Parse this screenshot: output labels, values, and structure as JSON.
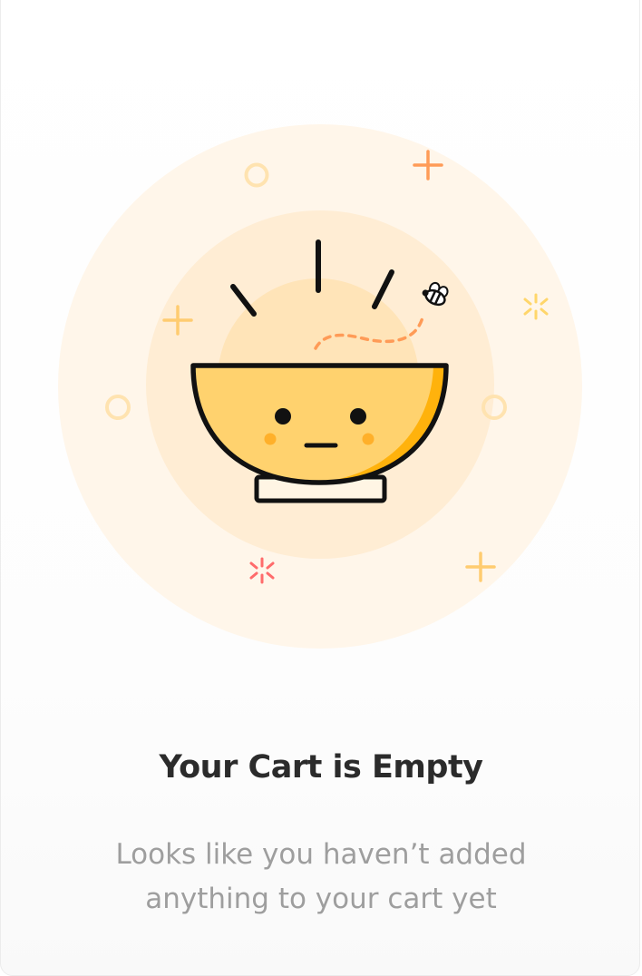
{
  "empty_state": {
    "title": "Your Cart is Empty",
    "message_line1": "Looks like you haven’t added",
    "message_line2": "anything to your cart yet"
  },
  "illustration": {
    "subject": "smiling-bowl",
    "decorations": [
      "plus-sign",
      "ring",
      "sparkle",
      "bee"
    ]
  },
  "colors": {
    "outer_glow": "#fff6ea",
    "middle_glow": "#ffedd4",
    "inner_glow": "#ffe4b8",
    "bowl_fill": "#ffd26e",
    "bowl_shadow": "#ffb20c",
    "outline": "#111111",
    "cheek": "#ffb02a",
    "title": "#2b2b2b",
    "message": "#9e9e9e",
    "accent_orange": "#ff9b57",
    "accent_yellow": "#ffd66b",
    "accent_pink": "#ff6b6b"
  }
}
